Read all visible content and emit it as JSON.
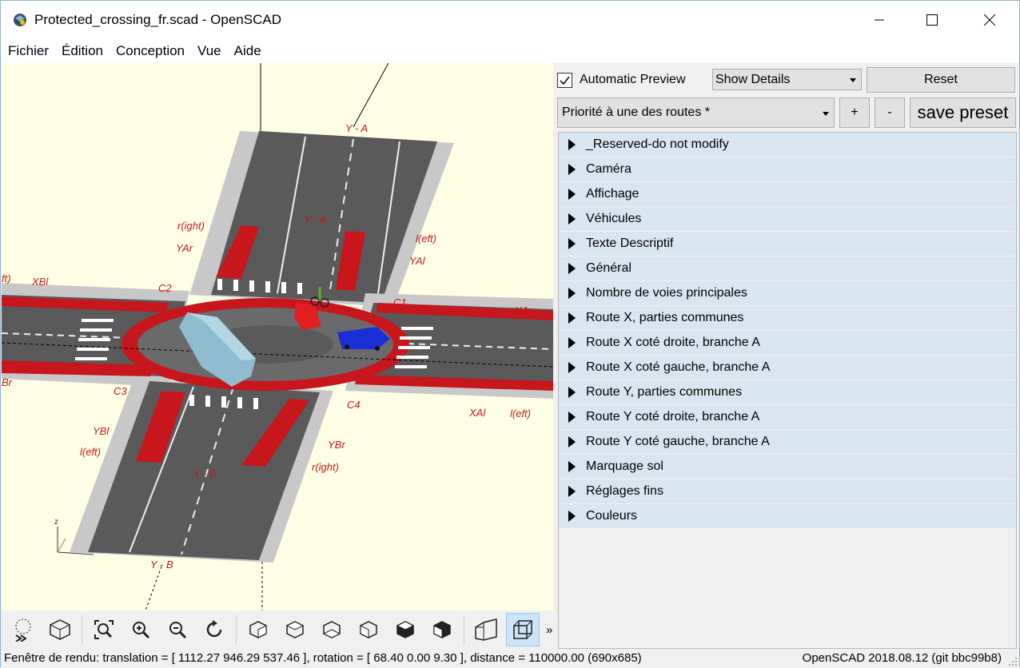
{
  "window": {
    "title": "Protected_crossing_fr.scad - OpenSCAD"
  },
  "menu": [
    "Fichier",
    "Édition",
    "Conception",
    "Vue",
    "Aide"
  ],
  "viewport": {
    "labels": {
      "ya_top": "Y - A",
      "ya_mid": "Y - A",
      "yb_mid": "Y - B",
      "yb_bottom": "Y - B",
      "right_top": "r(ight)",
      "right_bottom": "r(ight)",
      "left_top": "l(eft)",
      "left_bottom": "l(eft)",
      "left_right_edge": "l(eft)",
      "left_left_edge": "ft)",
      "yar": "YAr",
      "yal": "YAl",
      "ybl": "YBl",
      "ybr": "YBr",
      "xbl": "XBl",
      "xar": "XAr",
      "xal": "XAl",
      "xbr": "Br",
      "c1": "C1",
      "c2": "C2",
      "c3": "C3",
      "c4": "C4",
      "axis_z": "z"
    }
  },
  "toolbar": {
    "buttons": [
      {
        "name": "preview-render-button",
        "icon": "render-icon"
      },
      {
        "name": "view-all-solid-button",
        "icon": "solid-icon"
      },
      {
        "name": "view-all-button",
        "icon": "view-all-icon"
      },
      {
        "name": "zoom-in-button",
        "icon": "zoom-in-icon"
      },
      {
        "name": "zoom-out-button",
        "icon": "zoom-out-icon"
      },
      {
        "name": "reset-view-button",
        "icon": "reset-icon"
      },
      {
        "name": "view-right-button",
        "icon": "view-right-icon"
      },
      {
        "name": "view-top-button",
        "icon": "view-top-icon"
      },
      {
        "name": "view-bottom-button",
        "icon": "view-bottom-icon"
      },
      {
        "name": "view-left-button",
        "icon": "view-left-icon"
      },
      {
        "name": "view-front-button",
        "icon": "view-front-icon"
      },
      {
        "name": "view-back-button",
        "icon": "view-back-icon"
      },
      {
        "name": "perspective-button",
        "icon": "perspective-icon"
      },
      {
        "name": "orthogonal-button",
        "icon": "orthogonal-icon"
      }
    ],
    "more": "»"
  },
  "customizer": {
    "auto_preview_label": "Automatic Preview",
    "auto_preview_checked": true,
    "details_select": "Show Details",
    "reset_label": "Reset",
    "preset_select": "Priorité à une des routes *",
    "plus_label": "+",
    "minus_label": "-",
    "save_preset_label": "save preset",
    "groups": [
      "_Reserved-do not modify",
      "Caméra",
      "Affichage",
      "Véhicules",
      "Texte Descriptif",
      "Général",
      "Nombre de voies principales",
      "Route X, parties communes",
      "Route X coté droite, branche A",
      "Route X coté gauche, branche A",
      "Route Y, parties communes",
      "Route Y coté droite, branche A",
      "Route Y coté gauche, branche A",
      "Marquage sol",
      "Réglages fins",
      "Couleurs"
    ]
  },
  "status": {
    "left": "Fenêtre de rendu: translation = [ 1112.27 946.29 537.46 ], rotation = [ 68.40 0.00 9.30 ], distance = 110000.00 (690x685)",
    "right": "OpenSCAD 2018.08.12 (git bbc99b8)"
  },
  "colors": {
    "viewport_bg": "#ffffe5",
    "road": "#5a5a5a",
    "bike_lane": "#c8161d",
    "sidewalk": "#c8c8c8",
    "label": "#c8161d",
    "group_bg": "#d9e6f2"
  }
}
